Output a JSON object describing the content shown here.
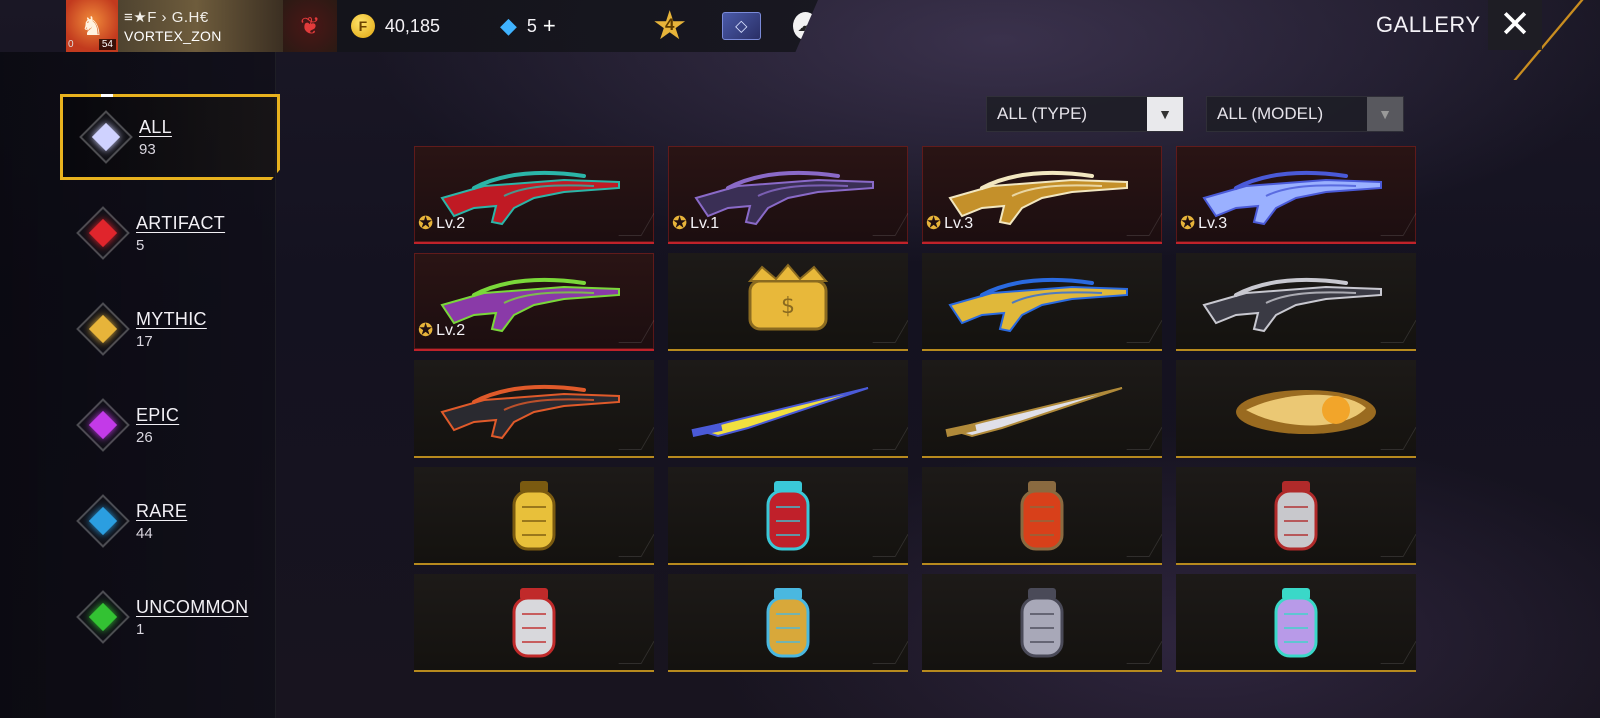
{
  "header": {
    "profile": {
      "guild_tag": "≡★F › G.H€",
      "player_name": "VORTEX_ZON",
      "level": "54",
      "rank_mini": "0"
    },
    "gold": "40,185",
    "gold_symbol": "F",
    "diamonds": "5",
    "plus_label": "+",
    "rank_number": "4",
    "title": "GALLERY",
    "close_label": "✕"
  },
  "categories": [
    {
      "label": "ALL",
      "count": "93",
      "color": "#cfd2ff",
      "active": true
    },
    {
      "label": "ARTIFACT",
      "count": "5",
      "color": "#e0252c"
    },
    {
      "label": "MYTHIC",
      "count": "17",
      "color": "#e7b43a"
    },
    {
      "label": "EPIC",
      "count": "26",
      "color": "#c33ae8"
    },
    {
      "label": "RARE",
      "count": "44",
      "color": "#2b9ee0"
    },
    {
      "label": "UNCOMMON",
      "count": "1",
      "color": "#33c233"
    }
  ],
  "filters": {
    "type": "ALL (TYPE)",
    "model": "ALL (MODEL)"
  },
  "items": [
    {
      "kind": "gun",
      "rarity": "red",
      "level": "Lv.2",
      "colors": [
        "#2bb5a8",
        "#c01a24"
      ]
    },
    {
      "kind": "gun",
      "rarity": "red",
      "level": "Lv.1",
      "colors": [
        "#8a6ac8",
        "#3a2f55"
      ]
    },
    {
      "kind": "gun",
      "rarity": "red",
      "level": "Lv.3",
      "colors": [
        "#f2e7c0",
        "#c4902a"
      ]
    },
    {
      "kind": "gun",
      "rarity": "red",
      "level": "Lv.3",
      "colors": [
        "#4a5ad8",
        "#9ab0ff"
      ]
    },
    {
      "kind": "gun",
      "rarity": "red",
      "level": "Lv.2",
      "colors": [
        "#7ad83a",
        "#8a3aa8"
      ]
    },
    {
      "kind": "crown",
      "rarity": "gold",
      "level": "",
      "colors": [
        "#e8b83a",
        "#8a6a20"
      ]
    },
    {
      "kind": "gun",
      "rarity": "gold",
      "level": "",
      "colors": [
        "#2a6ae0",
        "#e0b83a"
      ]
    },
    {
      "kind": "gun",
      "rarity": "gold",
      "level": "",
      "colors": [
        "#c8c8d0",
        "#3a3a44"
      ]
    },
    {
      "kind": "gun",
      "rarity": "gold",
      "level": "",
      "colors": [
        "#e05a2a",
        "#2a2a30"
      ]
    },
    {
      "kind": "blade",
      "rarity": "gold",
      "level": "",
      "colors": [
        "#f2e040",
        "#4a5ad8"
      ]
    },
    {
      "kind": "blade",
      "rarity": "gold",
      "level": "",
      "colors": [
        "#e0e0e8",
        "#b08a3a"
      ]
    },
    {
      "kind": "flame",
      "rarity": "gold",
      "level": "",
      "colors": [
        "#f2a52a",
        "#ffe08a"
      ]
    },
    {
      "kind": "grenade",
      "rarity": "gold",
      "level": "",
      "colors": [
        "#e8c03a",
        "#7a5a10"
      ]
    },
    {
      "kind": "grenade",
      "rarity": "gold",
      "level": "",
      "colors": [
        "#c0202a",
        "#3ac8d8"
      ]
    },
    {
      "kind": "grenade",
      "rarity": "gold",
      "level": "",
      "colors": [
        "#d8401a",
        "#8a6a40"
      ]
    },
    {
      "kind": "grenade",
      "rarity": "gold",
      "level": "",
      "colors": [
        "#c8c8cc",
        "#b02a2a"
      ]
    },
    {
      "kind": "grenade",
      "rarity": "gold",
      "level": "",
      "colors": [
        "#d8d8dc",
        "#c02a2a"
      ]
    },
    {
      "kind": "grenade",
      "rarity": "gold",
      "level": "",
      "colors": [
        "#d8a83a",
        "#4ab8e0"
      ]
    },
    {
      "kind": "grenade",
      "rarity": "gold",
      "level": "",
      "colors": [
        "#a8a8b8",
        "#4a4a58"
      ]
    },
    {
      "kind": "grenade",
      "rarity": "gold",
      "level": "",
      "colors": [
        "#b89ae8",
        "#3ad8c8"
      ]
    }
  ]
}
